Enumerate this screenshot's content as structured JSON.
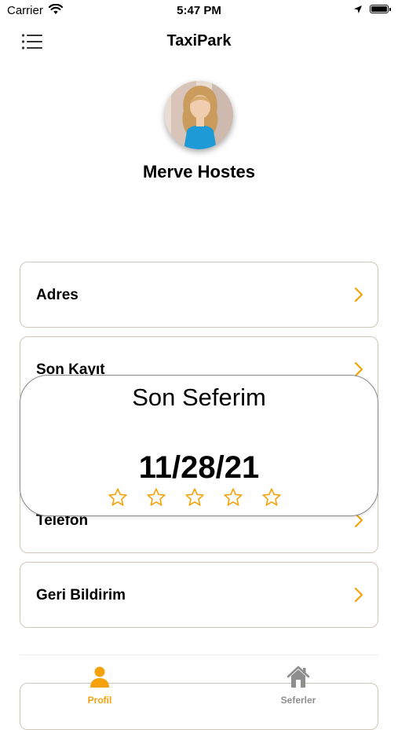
{
  "status_bar": {
    "carrier": "Carrier",
    "time": "5:47 PM"
  },
  "nav": {
    "title": "TaxiPark",
    "menu_icon": "list-icon"
  },
  "profile": {
    "name": "Merve Hostes",
    "avatar": "avatar-photo"
  },
  "rows": [
    {
      "label": "Adres",
      "icon": "chevron-right-icon"
    },
    {
      "label": "Son Kayıt",
      "icon": "chevron-right-icon"
    },
    {
      "label": "Telefon",
      "icon": "chevron-right-icon"
    },
    {
      "label": "Geri Bildirim",
      "icon": "chevron-right-icon"
    }
  ],
  "popup": {
    "title": "Son Seferim",
    "date": "11/28/21",
    "rating": {
      "value": 0,
      "max": 5
    }
  },
  "tabbar": {
    "tabs": [
      {
        "label": "Profil",
        "icon": "person-icon",
        "active": true
      },
      {
        "label": "Seferler",
        "icon": "house-icon",
        "active": false
      }
    ]
  },
  "colors": {
    "accent": "#f5a20a",
    "inactive": "#8e8e8e",
    "border": "#cfc7b8",
    "popup_border": "#8a8a8a"
  }
}
